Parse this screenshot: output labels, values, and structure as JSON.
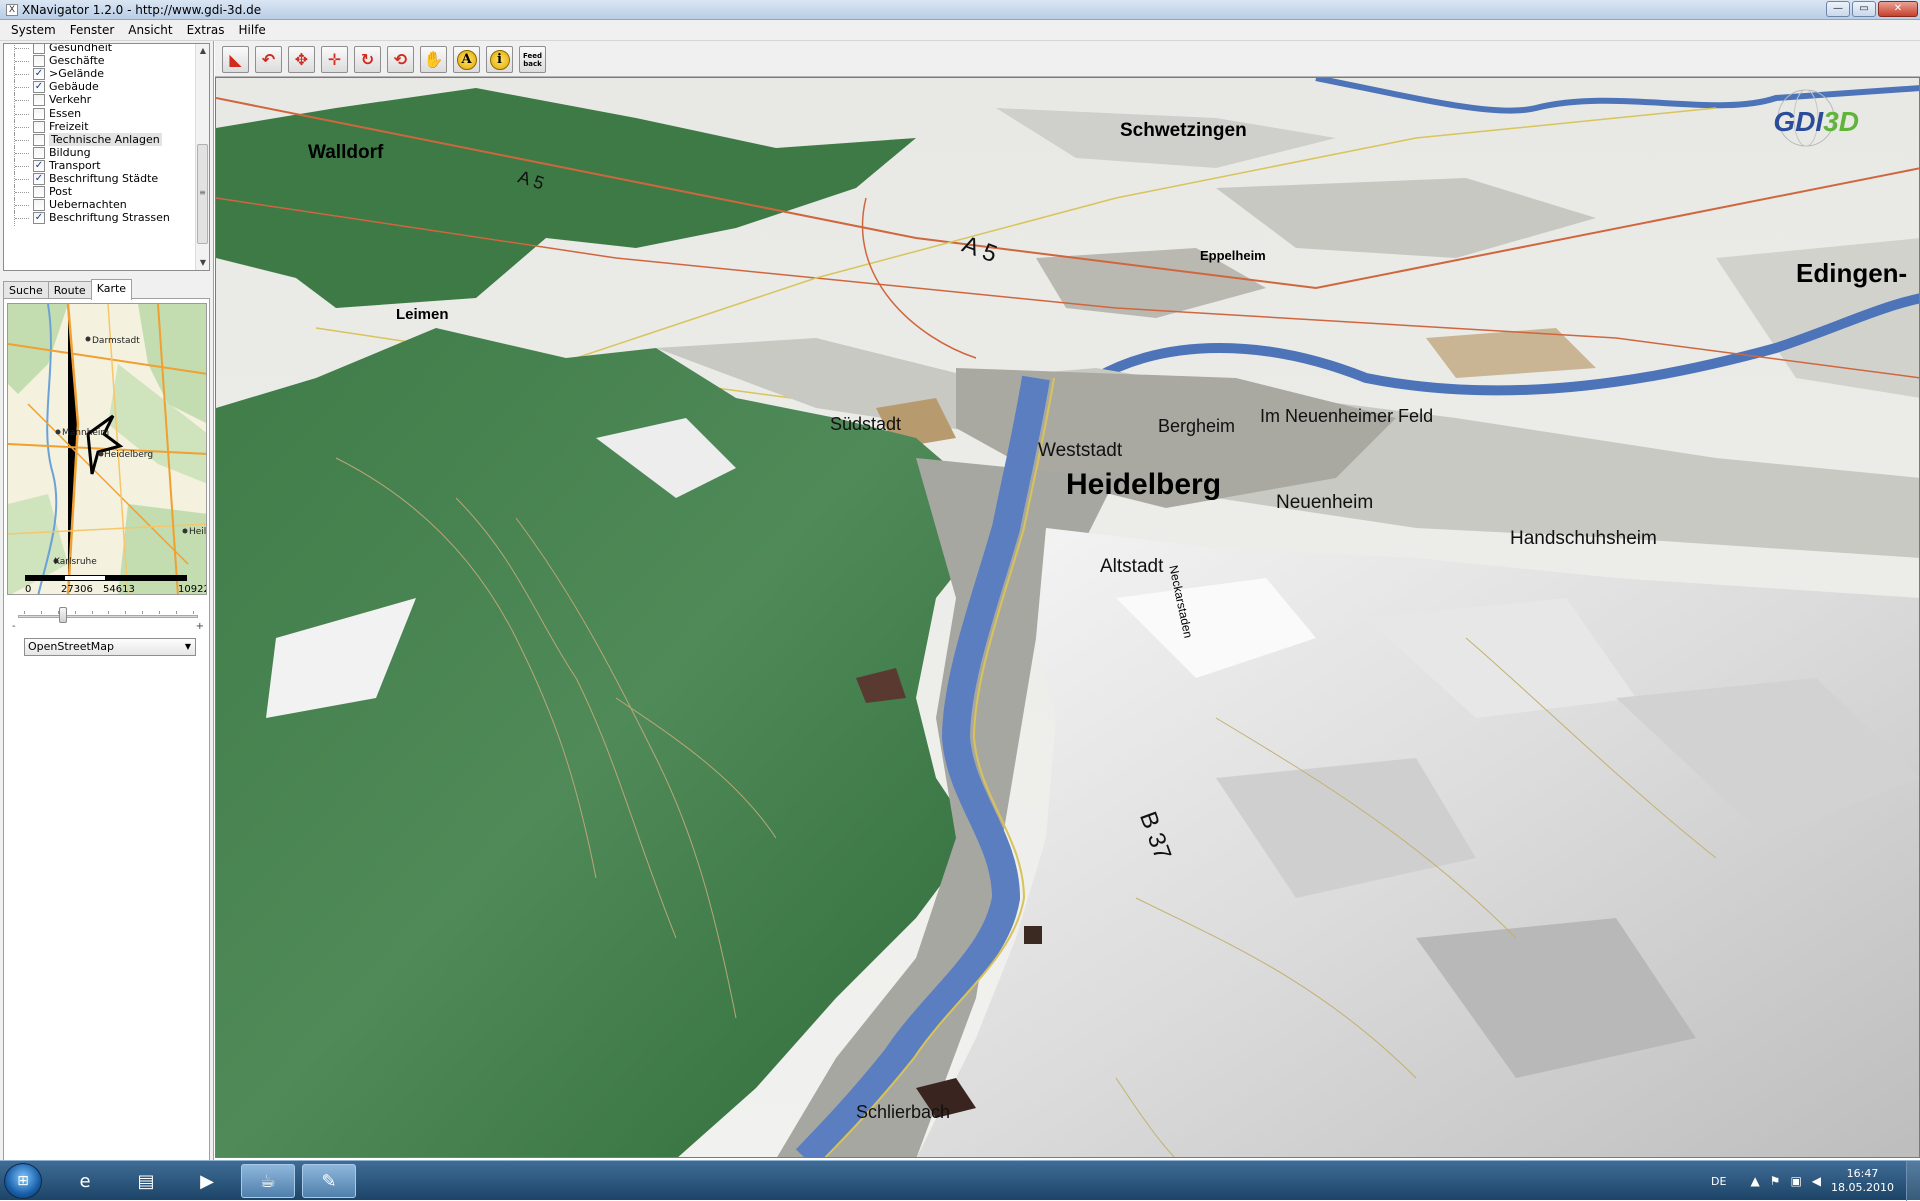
{
  "window": {
    "title": "XNavigator 1.2.0 - http://www.gdi-3d.de",
    "minimize": "—",
    "maximize": "▭",
    "close": "✕"
  },
  "menubar": [
    "System",
    "Fenster",
    "Ansicht",
    "Extras",
    "Hilfe"
  ],
  "layers": [
    {
      "label": "Gesundheit",
      "checked": false
    },
    {
      "label": "Geschäfte",
      "checked": false
    },
    {
      "label": ">Gelände",
      "checked": true
    },
    {
      "label": "Gebäude",
      "checked": true
    },
    {
      "label": "Verkehr",
      "checked": false
    },
    {
      "label": "Essen",
      "checked": false
    },
    {
      "label": "Freizeit",
      "checked": false
    },
    {
      "label": "Technische Anlagen",
      "checked": false,
      "selected": true
    },
    {
      "label": "Bildung",
      "checked": false
    },
    {
      "label": "Transport",
      "checked": true
    },
    {
      "label": "Beschriftung Städte",
      "checked": true
    },
    {
      "label": "Post",
      "checked": false
    },
    {
      "label": "Uebernachten",
      "checked": false
    },
    {
      "label": "Beschriftung Strassen",
      "checked": true
    }
  ],
  "tabs": [
    {
      "label": "Suche",
      "active": false
    },
    {
      "label": "Route",
      "active": false
    },
    {
      "label": "Karte",
      "active": true
    }
  ],
  "minimap": {
    "labels": [
      "Darmstadt",
      "Mannheim",
      "Heidelberg",
      "Heilt",
      "Karlsruhe"
    ],
    "scale_ticks": [
      "0",
      "27306",
      "54613",
      "10922"
    ]
  },
  "zoom_slider": {
    "minus": "-",
    "plus": "+",
    "level": 0.25
  },
  "map_source": {
    "selected": "OpenStreetMap"
  },
  "toolbar": {
    "tools": [
      {
        "name": "orbit-tool-icon",
        "glyph": "◣",
        "style": "red"
      },
      {
        "name": "tilt-tool-icon",
        "glyph": "↶",
        "style": "red"
      },
      {
        "name": "move-vertical-tool-icon",
        "glyph": "✥",
        "style": "red"
      },
      {
        "name": "move-tool-icon",
        "glyph": "✛",
        "style": "red"
      },
      {
        "name": "rotate-tool-icon",
        "glyph": "↻",
        "style": "red"
      },
      {
        "name": "undo-tool-icon",
        "glyph": "⟲",
        "style": "red"
      },
      {
        "name": "hand-tool-icon",
        "glyph": "✋",
        "style": "plain"
      },
      {
        "name": "annotation-tool-icon",
        "glyph": "A",
        "style": "yellow"
      },
      {
        "name": "info-tool-icon",
        "glyph": "i",
        "style": "yellow"
      }
    ],
    "feedback": "Feed back"
  },
  "map": {
    "logo_a": "GDI",
    "logo_b": "3D",
    "places_big": [
      "Heidelberg"
    ],
    "places_medium": [
      "Walldorf",
      "Schwetzingen",
      "Edingen-"
    ],
    "places_small": [
      "Eppelheim",
      "Leimen"
    ],
    "districts": [
      "Südstadt",
      "Weststadt",
      "Bergheim",
      "Im Neuenheimer Feld",
      "Neuenheim",
      "Handschuhsheim",
      "Altstadt",
      "Schlierbach"
    ],
    "street_labels": [
      "Neckarstaden"
    ],
    "road_labels": [
      "A 5",
      "A 5",
      "B 37"
    ]
  },
  "taskbar": {
    "language": "DE",
    "time": "16:47",
    "date": "18.05.2010",
    "apps": [
      {
        "name": "internet-explorer-icon",
        "glyph": "e",
        "active": false
      },
      {
        "name": "file-explorer-icon",
        "glyph": "▤",
        "active": false
      },
      {
        "name": "media-player-icon",
        "glyph": "▶",
        "active": false
      },
      {
        "name": "java-app-icon",
        "glyph": "☕",
        "active": true
      },
      {
        "name": "paint-app-icon",
        "glyph": "✎",
        "active": true
      }
    ]
  }
}
